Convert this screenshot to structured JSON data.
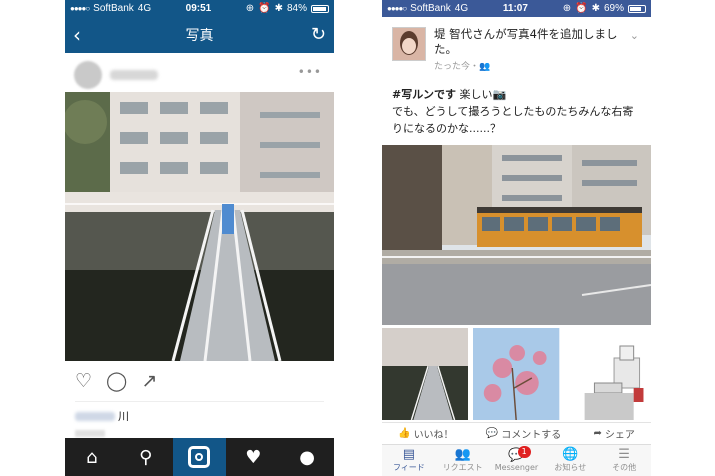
{
  "instagram": {
    "status": {
      "carrier": "SoftBank",
      "network": "4G",
      "time": "09:51",
      "battery": "84%",
      "battery_level": 0.84
    },
    "nav": {
      "title": "写真",
      "back_icon": "chevron-left-icon",
      "refresh_icon": "refresh-icon"
    },
    "post": {
      "more_label": "•••",
      "caption": "川"
    },
    "actions": [
      "heart-icon",
      "comment-icon",
      "share-icon"
    ],
    "tabs": [
      "home-icon",
      "search-icon",
      "camera-icon",
      "activity-icon",
      "profile-icon"
    ],
    "active_tab": 2
  },
  "facebook": {
    "status": {
      "carrier": "SoftBank",
      "network": "4G",
      "time": "11:07",
      "battery": "69%",
      "battery_level": 0.69
    },
    "post": {
      "author_line": "堤 智代さんが写真4件を追加しました。",
      "timestamp": "たった今・",
      "hashtag": "#写ルンです",
      "text_line1": " 楽しい",
      "text_line2": "でも、どうして撮ろうとしたものたちみんな右寄りになるのかな......？"
    },
    "actions": [
      {
        "label": "いいね！",
        "icon": "thumbs-up-icon"
      },
      {
        "label": "コメントする",
        "icon": "comment-icon"
      },
      {
        "label": "シェア",
        "icon": "share-icon"
      }
    ],
    "tabs": [
      {
        "label": "フィード",
        "icon": "feed-icon"
      },
      {
        "label": "リクエスト",
        "icon": "friends-icon"
      },
      {
        "label": "Messenger",
        "icon": "messenger-icon",
        "badge": "1"
      },
      {
        "label": "お知らせ",
        "icon": "globe-icon"
      },
      {
        "label": "その他",
        "icon": "menu-icon"
      }
    ],
    "active_tab": 0
  },
  "colors": {
    "instagram_blue": "#125688",
    "facebook_blue": "#3b5998"
  }
}
